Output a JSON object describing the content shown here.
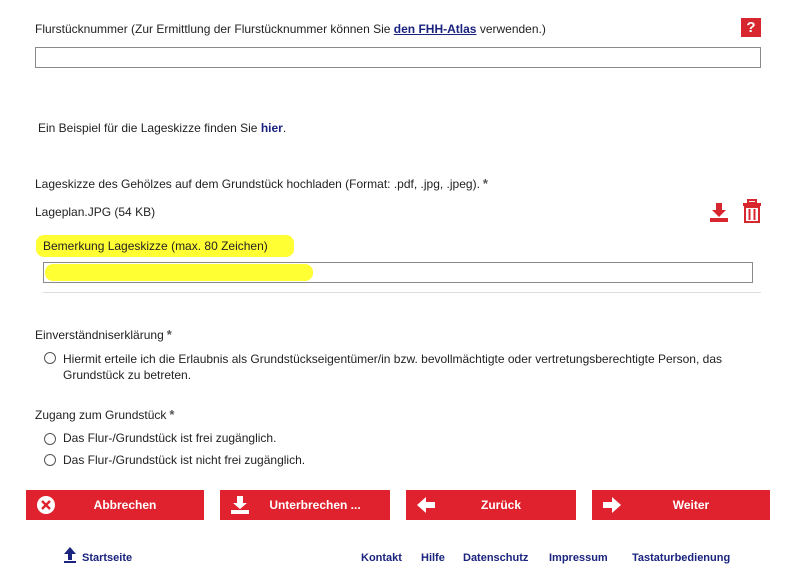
{
  "flurstueck": {
    "label_prefix": "Flurstücknummer (Zur Ermittlung der Flurstücknummer können Sie",
    "label_link": "den FHH-Atlas",
    "label_suffix": "verwenden.)",
    "help": "?",
    "value": ""
  },
  "beispiel": {
    "text_prefix": "Ein Beispiel für die Lageskizze finden Sie",
    "link": "hier",
    "text_suffix": "."
  },
  "upload": {
    "label": "Lageskizze des Gehölzes auf dem Grundstück hochladen (Format: .pdf, .jpg, .jpeg).",
    "required_mark": "*",
    "file": "Lageplan.JPG (54 KB)",
    "download_icon": "download-icon",
    "delete_icon": "trash-icon"
  },
  "bemerkung": {
    "label": "Bemerkung Lageskizze (max. 80 Zeichen)",
    "value": ""
  },
  "einverstaendnis": {
    "label": "Einverständniserklärung",
    "required_mark": "*",
    "option": "Hiermit erteile ich die Erlaubnis als Grundstückseigentümer/in bzw. bevollmächtigte oder vertretungsberechtigte Person, das Grundstück zu betreten."
  },
  "zugang": {
    "label": "Zugang zum Grundstück",
    "required_mark": "*",
    "options": [
      "Das Flur-/Grundstück ist frei zugänglich.",
      "Das Flur-/Grundstück ist nicht frei zugänglich."
    ]
  },
  "buttons": {
    "cancel": "Abbrechen",
    "interrupt": "Unterbrechen ...",
    "back": "Zurück",
    "next": "Weiter"
  },
  "footer": {
    "home": "Startseite",
    "links": [
      "Kontakt",
      "Hilfe",
      "Datenschutz",
      "Impressum",
      "Tastaturbedienung"
    ]
  },
  "colors": {
    "accent": "#e0222e",
    "link": "#1a237e",
    "highlight": "#ffff33"
  }
}
